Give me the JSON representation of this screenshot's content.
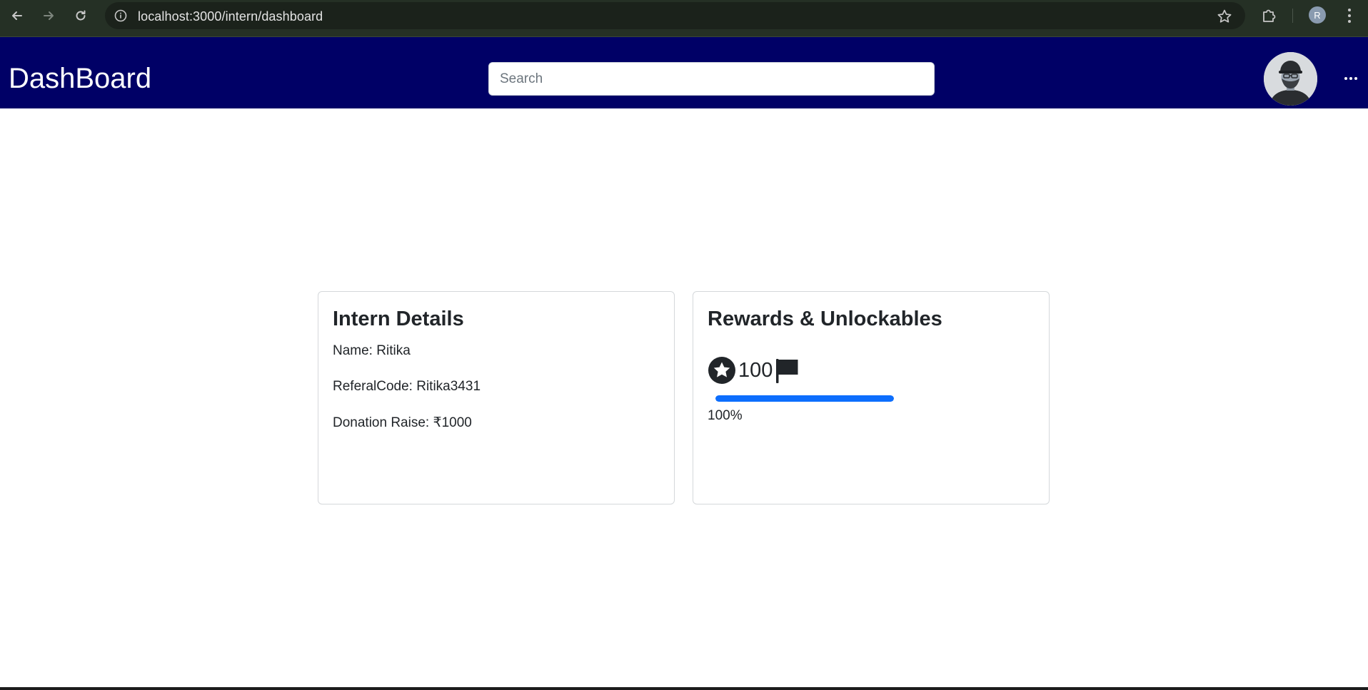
{
  "browser": {
    "url": "localhost:3000/intern/dashboard",
    "profile_initial": "R",
    "icons": {
      "back": "arrow-left-icon",
      "forward": "arrow-right-icon",
      "reload": "reload-icon",
      "site_info": "info-icon",
      "bookmark": "star-outline-icon",
      "extensions": "puzzle-icon",
      "menu": "kebab-vertical-icon"
    }
  },
  "navbar": {
    "brand": "DashBoard",
    "search_placeholder": "Search",
    "background_color": "#000066",
    "avatar_icon": "user-avatar-icon",
    "more_icon": "more-horizontal-icon"
  },
  "intern_card": {
    "title": "Intern Details",
    "fields": [
      {
        "label": "Name:",
        "value": "Ritika"
      },
      {
        "label": "ReferalCode:",
        "value": "Ritika3431"
      },
      {
        "label": "Donation Raise:",
        "value": "₹1000"
      }
    ]
  },
  "rewards_card": {
    "title": "Rewards & Unlockables",
    "star_icon": "star-circle-icon",
    "points": "100",
    "flag_icon": "flag-icon",
    "progress_percent": 100,
    "progress_label": "100%",
    "progress_color": "#0d6efd"
  }
}
